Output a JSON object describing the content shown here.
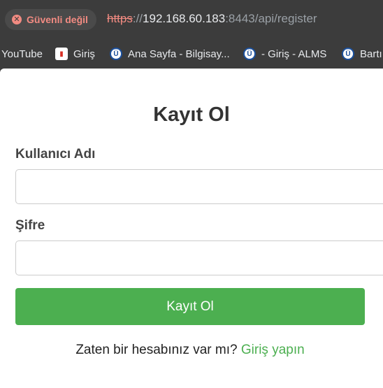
{
  "browser": {
    "security_label": "Güvenli değil",
    "url_scheme": "https",
    "url_sep": "://",
    "url_host": "192.168.60.183",
    "url_rest": ":8443/api/register"
  },
  "bookmarks": [
    {
      "label": "YouTube",
      "icon": "youtube-icon"
    },
    {
      "label": "Giriş",
      "icon": "document-icon"
    },
    {
      "label": "Ana Sayfa - Bilgisay...",
      "icon": "university-logo-icon"
    },
    {
      "label": "- Giriş - ALMS",
      "icon": "university-logo-icon"
    },
    {
      "label": "Bartı",
      "icon": "university-logo-icon"
    }
  ],
  "form": {
    "title": "Kayıt Ol",
    "username_label": "Kullanıcı Adı",
    "username_value": "",
    "password_label": "Şifre",
    "password_value": "",
    "submit_label": "Kayıt Ol",
    "footer_text": "Zaten bir hesabınız var mı?",
    "login_link": "Giriş yapın"
  },
  "colors": {
    "accent": "#4caf50",
    "warning": "#f28b82"
  }
}
